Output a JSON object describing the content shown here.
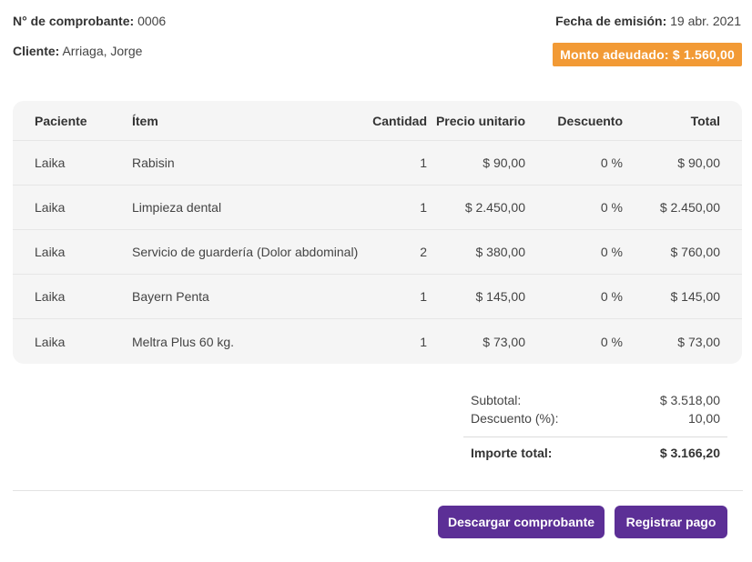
{
  "header": {
    "receipt_label": "N° de comprobante:",
    "receipt_value": "0006",
    "client_label": "Cliente:",
    "client_value": "Arriaga, Jorge",
    "date_label": "Fecha de emisión:",
    "date_value": "19 abr. 2021",
    "amount_due_badge": "Monto adeudado: $ 1.560,00",
    "badge_color": "#f29a35"
  },
  "table": {
    "columns": [
      "Paciente",
      "Ítem",
      "Cantidad",
      "Precio unitario",
      "Descuento",
      "Total"
    ],
    "rows": [
      [
        "Laika",
        "Rabisin",
        "1",
        "$ 90,00",
        "0 %",
        "$ 90,00"
      ],
      [
        "Laika",
        "Limpieza dental",
        "1",
        "$ 2.450,00",
        "0 %",
        "$ 2.450,00"
      ],
      [
        "Laika",
        "Servicio de guardería (Dolor abdominal)",
        "2",
        "$ 380,00",
        "0 %",
        "$ 760,00"
      ],
      [
        "Laika",
        "Bayern Penta",
        "1",
        "$ 145,00",
        "0 %",
        "$ 145,00"
      ],
      [
        "Laika",
        "Meltra Plus 60 kg.",
        "1",
        "$ 73,00",
        "0 %",
        "$ 73,00"
      ]
    ]
  },
  "totals": {
    "subtotal_label": "Subtotal:",
    "subtotal_value": "$ 3.518,00",
    "discount_label": "Descuento (%):",
    "discount_value": "10,00",
    "total_label": "Importe total:",
    "total_value": "$ 3.166,20"
  },
  "actions": {
    "download_label": "Descargar comprobante",
    "pay_label": "Registrar pago",
    "button_color": "#5c2f96"
  }
}
